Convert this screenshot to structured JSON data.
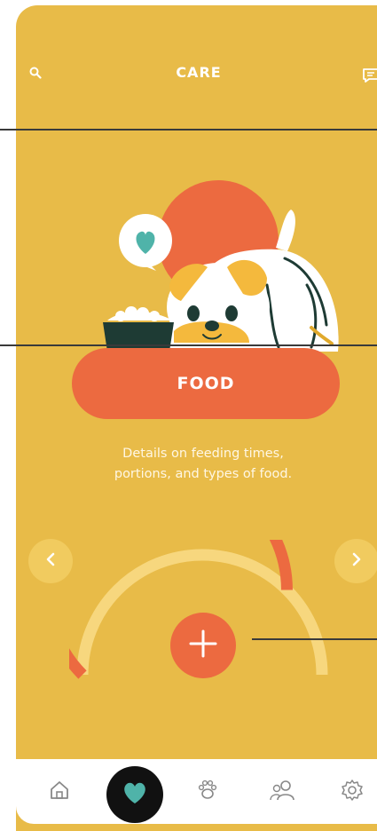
{
  "header": {
    "title": "CARE",
    "left_icon": "search-icon",
    "right_icon": "chat-icon"
  },
  "card": {
    "illustration": "dog-with-food-bowl-and-heart-bubble",
    "label": "FOOD",
    "description_line1": "Details on feeding times,",
    "description_line2": "portions, and types of food."
  },
  "carousel": {
    "prev_icon": "chevron-left-icon",
    "next_icon": "chevron-right-icon"
  },
  "gauge": {
    "progress": 0.75,
    "filled_color": "#ec6a40",
    "track_color": "#f7d77e",
    "add_icon": "plus-icon"
  },
  "bottom_nav": {
    "items": [
      {
        "icon": "home-icon",
        "active": false
      },
      {
        "icon": "heart-icon",
        "active": true
      },
      {
        "icon": "paw-icon",
        "active": false
      },
      {
        "icon": "people-icon",
        "active": false
      },
      {
        "icon": "gear-icon",
        "active": false
      }
    ]
  },
  "colors": {
    "background": "#e8bb48",
    "accent": "#ec6a40",
    "dark": "#111111",
    "teal": "#4fb3a9"
  }
}
